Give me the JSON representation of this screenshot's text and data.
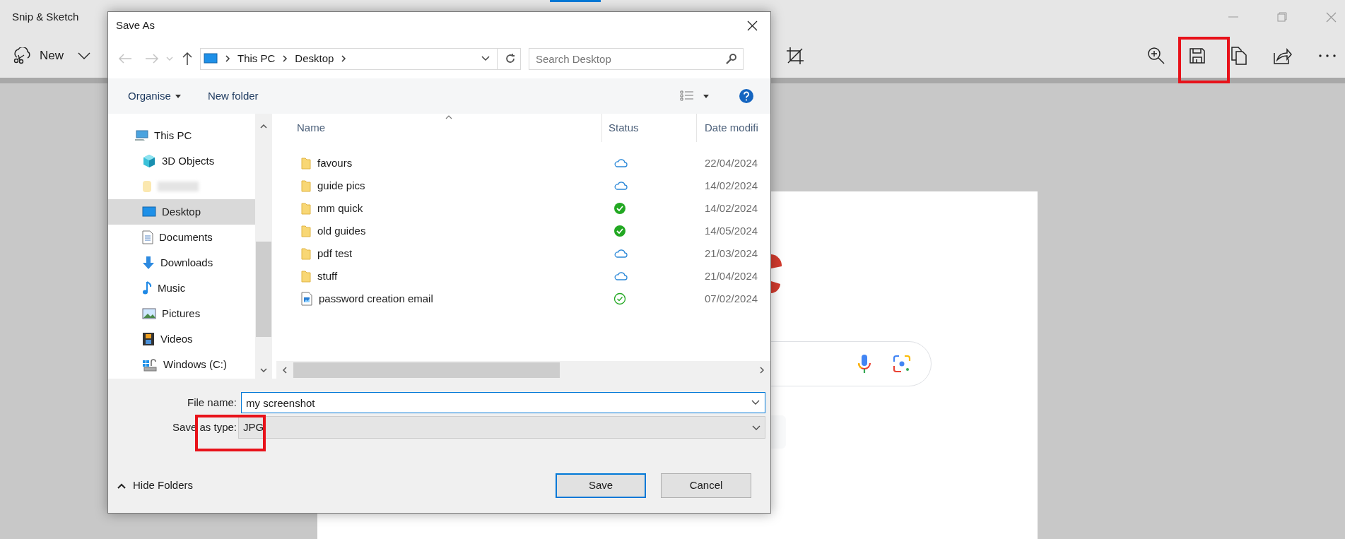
{
  "app": {
    "title": "Snip & Sketch",
    "new_button": "New"
  },
  "dialog": {
    "title": "Save As",
    "address": [
      "This PC",
      "Desktop"
    ],
    "search": {
      "placeholder": "Search Desktop"
    },
    "commands": [
      "Organise",
      "New folder"
    ],
    "navigation": [
      {
        "label": "This PC",
        "kind": "pc",
        "selected": false,
        "children": [
          {
            "label": "3D Objects",
            "kind": "objects",
            "selected": false
          },
          {
            "kind": "blurred",
            "selected": false
          },
          {
            "label": "Desktop",
            "kind": "desktop",
            "selected": true
          },
          {
            "label": "Documents",
            "kind": "documents",
            "selected": false
          },
          {
            "label": "Downloads",
            "kind": "downloads",
            "selected": false
          },
          {
            "label": "Music",
            "kind": "music",
            "selected": false
          },
          {
            "label": "Pictures",
            "kind": "pictures",
            "selected": false
          },
          {
            "label": "Videos",
            "kind": "videos",
            "selected": false
          },
          {
            "label": "Windows (C:)",
            "kind": "drive",
            "selected": false
          }
        ]
      }
    ],
    "columns": [
      "Name",
      "Status",
      "Date modifi"
    ],
    "files": [
      {
        "name": "favours",
        "kind": "folder",
        "status": {
          "kind": "online-only"
        },
        "date": "22/04/2024"
      },
      {
        "name": "guide pics",
        "kind": "folder",
        "status": {
          "kind": "online-only"
        },
        "date": "14/02/2024"
      },
      {
        "name": "mm quick",
        "kind": "folder",
        "status": {
          "kind": "always-available"
        },
        "date": "14/02/2024"
      },
      {
        "name": "old guides",
        "kind": "folder",
        "status": {
          "kind": "always-available"
        },
        "date": "14/05/2024"
      },
      {
        "name": "pdf test",
        "kind": "folder",
        "status": {
          "kind": "online-only"
        },
        "date": "21/03/2024"
      },
      {
        "name": "stuff",
        "kind": "folder",
        "status": {
          "kind": "online-only"
        },
        "date": "21/04/2024"
      },
      {
        "name": "password creation email",
        "kind": "image",
        "status": {
          "kind": "available"
        },
        "date": "07/02/2024"
      }
    ],
    "file_name": {
      "label": "File name:",
      "value": "my screenshot"
    },
    "save_type": {
      "label": "Save as type:",
      "value": "JPG"
    },
    "hide_folders": "Hide Folders",
    "buttons": [
      {
        "label": "Save",
        "default": true
      },
      {
        "label": "Cancel",
        "default": false
      }
    ]
  }
}
